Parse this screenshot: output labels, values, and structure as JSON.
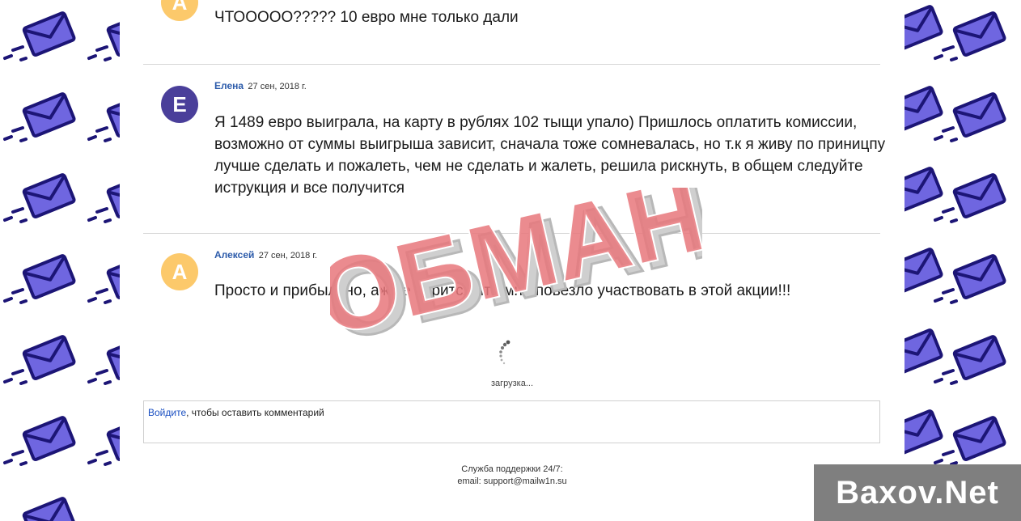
{
  "comments": [
    {
      "avatar_letter": "А",
      "author": "",
      "date": "",
      "text": "ЧТООООО????? 10 евро мне только дали"
    },
    {
      "avatar_letter": "Е",
      "author": "Елена",
      "date": "27 сен, 2018 г.",
      "text": "Я 1489 евро выиграла, на карту в рублях 102 тыщи упало) Пришлось оплатить комиссии, возможно от суммы выигрыша зависит, сначала тоже сомневалась, но т.к я живу по приницпу лучше сделать и пожалеть, чем не сделать и жалеть, решила рискнуть, в общем следуйте иструкция и все получится"
    },
    {
      "avatar_letter": "А",
      "author": "Алексей",
      "date": "27 сен, 2018 г.",
      "text": "Просто и прибыльно, аж не верится что мне повезло участвовать в этой акции!!!"
    }
  ],
  "loading_text": "загрузка...",
  "login": {
    "link_text": "Войдите",
    "rest_text": ", чтобы оставить комментарий"
  },
  "footer": {
    "line1": "Служба поддержки 24/7:",
    "line2": "email: support@mailw1n.su"
  },
  "stamp_text": "ОБМАН",
  "watermark_text": "Baxov.Net",
  "colors": {
    "avatar_orange": "#fcc96b",
    "avatar_purple": "#4a3f9a",
    "author_link": "#2c5baa",
    "stamp_red": "#e8777b",
    "envelope_fill": "#6f66e0",
    "envelope_stroke": "#1c1576"
  },
  "icons": {
    "background": "envelope-icon",
    "spinner": "loading-spinner-icon"
  }
}
